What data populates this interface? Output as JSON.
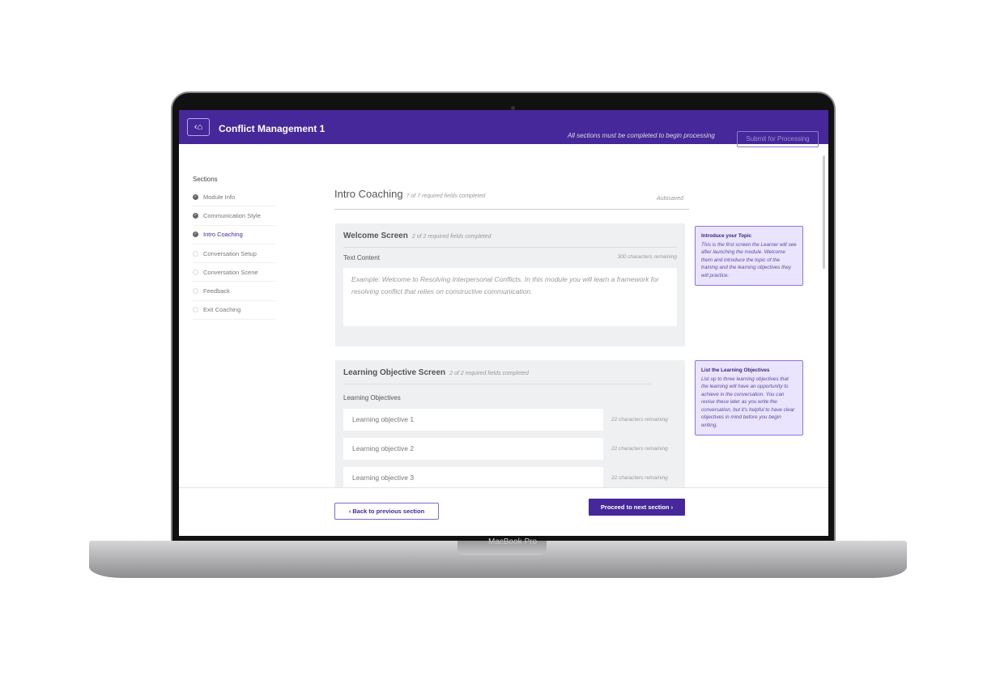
{
  "device": {
    "brand": "MacBook Pro"
  },
  "header": {
    "title": "Conflict Management 1",
    "warning": "All sections must be completed to begin processing",
    "submit_label": "Submit for Processing",
    "home_icon": "home-icon"
  },
  "sidebar": {
    "heading": "Sections",
    "items": [
      {
        "label": "Module Info",
        "done": true
      },
      {
        "label": "Communication Style",
        "done": true
      },
      {
        "label": "Intro Coaching",
        "done": true,
        "active": true
      },
      {
        "label": "Conversation Setup",
        "done": false
      },
      {
        "label": "Conversation Scene",
        "done": false
      },
      {
        "label": "Feedback",
        "done": false
      },
      {
        "label": "Exit Coaching",
        "done": false
      }
    ]
  },
  "page": {
    "title": "Intro Coaching",
    "progress": "7 of 7 required fields completed",
    "status": "Autosaved"
  },
  "welcome": {
    "title": "Welcome Screen",
    "progress": "2 of 2 required fields completed",
    "field_label": "Text Content",
    "remaining": "300 characters remaining",
    "placeholder": "Example: Welcome to Resolving Interpersonal Conflicts. In this module you will learn a framework for resolving conflict that relies on constructive communication."
  },
  "objectives": {
    "title": "Learning Objective Screen",
    "progress": "2 of 2 required fields completed",
    "field_label": "Learning Objectives",
    "items": [
      {
        "placeholder": "Learning objective 1",
        "remaining": "22 characters remaining"
      },
      {
        "placeholder": "Learning objective 2",
        "remaining": "22 characters remaining"
      },
      {
        "placeholder": "Learning objective 3",
        "remaining": "22 characters remaining"
      }
    ]
  },
  "tips": [
    {
      "title": "Introduce your Topic",
      "body": "This is the first screen the Learner will see after launching the module. Welcome them and introduce the topic of the training and the learning objectives they will practice."
    },
    {
      "title": "List the Learning Objectives",
      "body": "List up to three learning objectives that the learning will have an opportunity to achieve in the conversation. You can revise these later as you write the conversation, but it's helpful to have clear objectives in mind before you begin writing."
    }
  ],
  "footer": {
    "back_label": "‹  Back to previous section",
    "next_label": "Proceed to next section  ›"
  },
  "colors": {
    "brand": "#46289a",
    "tip_bg": "#ebe4ff",
    "card_bg": "#eff0f2"
  }
}
